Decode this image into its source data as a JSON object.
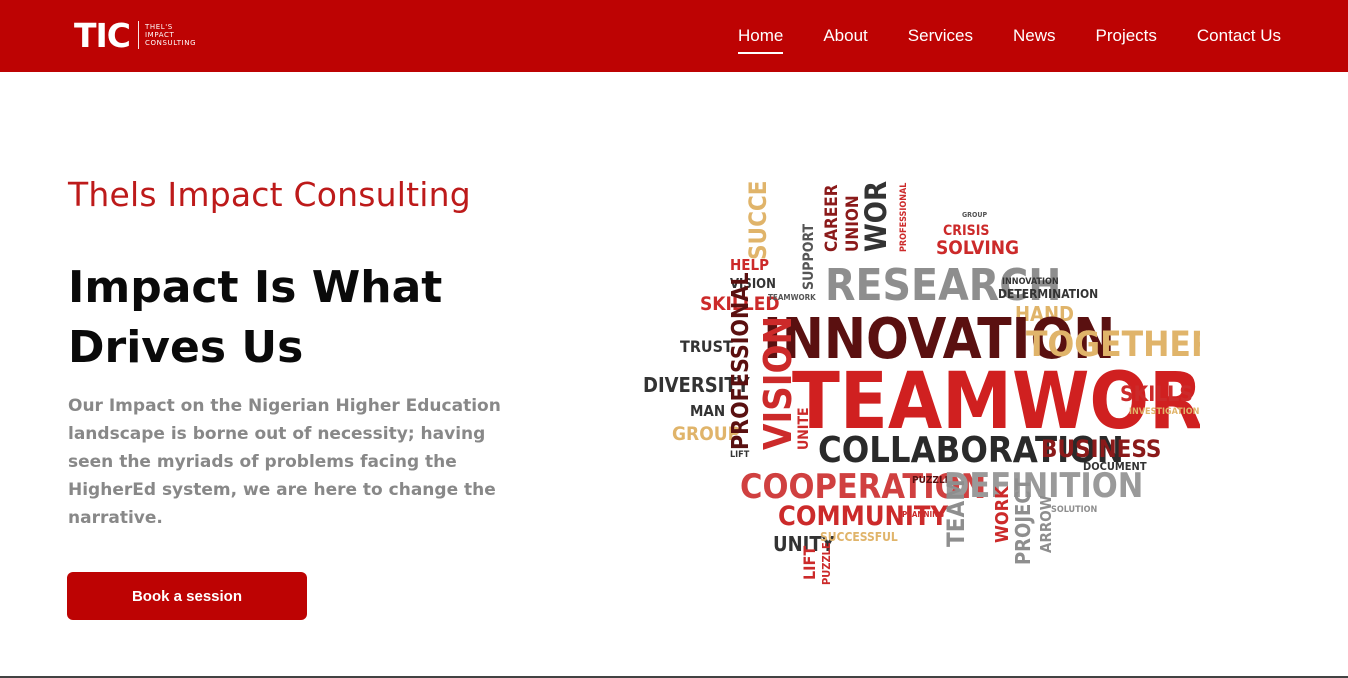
{
  "brand": {
    "mark": "TIC",
    "tagline_lines": [
      "THEL'S",
      "IMPACT",
      "CONSULTING"
    ],
    "primary_color": "#bd0303"
  },
  "nav": {
    "items": [
      {
        "label": "Home",
        "active": true
      },
      {
        "label": "About"
      },
      {
        "label": "Services"
      },
      {
        "label": "News"
      },
      {
        "label": "Projects"
      },
      {
        "label": "Contact Us"
      }
    ]
  },
  "hero": {
    "eyebrow": "Thels Impact Consulting",
    "headline_line1": "Impact Is What",
    "headline_line2": "Drives Us",
    "body": "Our Impact on the Nigerian Higher Education landscape is borne out of necessity; having seen the myriads of problems facing the HigherEd system, we are here to change the narrative.",
    "cta_label": "Book a session"
  },
  "word_cloud": {
    "words": [
      {
        "text": "SUCCESS",
        "color": "#e0b46a"
      },
      {
        "text": "CAREER",
        "color": "#8b1a1a"
      },
      {
        "text": "UNION",
        "color": "#8b1a1a"
      },
      {
        "text": "WORK",
        "color": "#333333"
      },
      {
        "text": "PROFESSIONAL",
        "color": "#cc2a2a"
      },
      {
        "text": "GROUP",
        "color": "#555555"
      },
      {
        "text": "CRISIS",
        "color": "#cc2a2a"
      },
      {
        "text": "SOLVING",
        "color": "#cc2a2a"
      },
      {
        "text": "HELP",
        "color": "#cc2a2a"
      },
      {
        "text": "VISION",
        "color": "#333333"
      },
      {
        "text": "SUPPORT",
        "color": "#555555"
      },
      {
        "text": "RESEARCH",
        "color": "#8e8e8e"
      },
      {
        "text": "INNOVATION",
        "color": "#333333"
      },
      {
        "text": "DETERMINATION",
        "color": "#333333"
      },
      {
        "text": "SKILLED",
        "color": "#cc2a2a"
      },
      {
        "text": "TEAMWORK",
        "color": "#555555"
      },
      {
        "text": "HAND",
        "color": "#e0b46a"
      },
      {
        "text": "TRUST",
        "color": "#333333"
      },
      {
        "text": "INNOVATION",
        "color": "#5a1010"
      },
      {
        "text": "TOGETHER",
        "color": "#e0b46a"
      },
      {
        "text": "DIVERSITY",
        "color": "#333333"
      },
      {
        "text": "TEAMWORK",
        "color": "#d02020"
      },
      {
        "text": "SKILLS",
        "color": "#cc2a2a"
      },
      {
        "text": "MAN",
        "color": "#333333"
      },
      {
        "text": "VISION",
        "color": "#cc2a2a"
      },
      {
        "text": "INVESTIGATION",
        "color": "#e0b46a"
      },
      {
        "text": "GROUP",
        "color": "#e0b46a"
      },
      {
        "text": "PROFESSIONAL",
        "color": "#5a1010"
      },
      {
        "text": "UNITE",
        "color": "#cc2a2a"
      },
      {
        "text": "COLLABORATION",
        "color": "#2a2a2a"
      },
      {
        "text": "BUSINESS",
        "color": "#8b1a1a"
      },
      {
        "text": "LIFT",
        "color": "#333333"
      },
      {
        "text": "DOCUMENT",
        "color": "#333333"
      },
      {
        "text": "COOPERATION",
        "color": "#d04040"
      },
      {
        "text": "PUZZLE",
        "color": "#5a1010"
      },
      {
        "text": "DEFINITION",
        "color": "#9a9a9a"
      },
      {
        "text": "COMMUNITY",
        "color": "#cc2a2a"
      },
      {
        "text": "PLANNING",
        "color": "#cc2a2a"
      },
      {
        "text": "TEAM",
        "color": "#8e8e8e"
      },
      {
        "text": "WORK",
        "color": "#cc2a2a"
      },
      {
        "text": "PROJECT",
        "color": "#8e8e8e"
      },
      {
        "text": "ARROW",
        "color": "#8e8e8e"
      },
      {
        "text": "SOLUTION",
        "color": "#8e8e8e"
      },
      {
        "text": "UNITY",
        "color": "#333333"
      },
      {
        "text": "SUCCESSFUL",
        "color": "#e0b46a"
      },
      {
        "text": "LIFT",
        "color": "#cc2a2a"
      },
      {
        "text": "PUZZLE",
        "color": "#cc2a2a"
      }
    ]
  }
}
